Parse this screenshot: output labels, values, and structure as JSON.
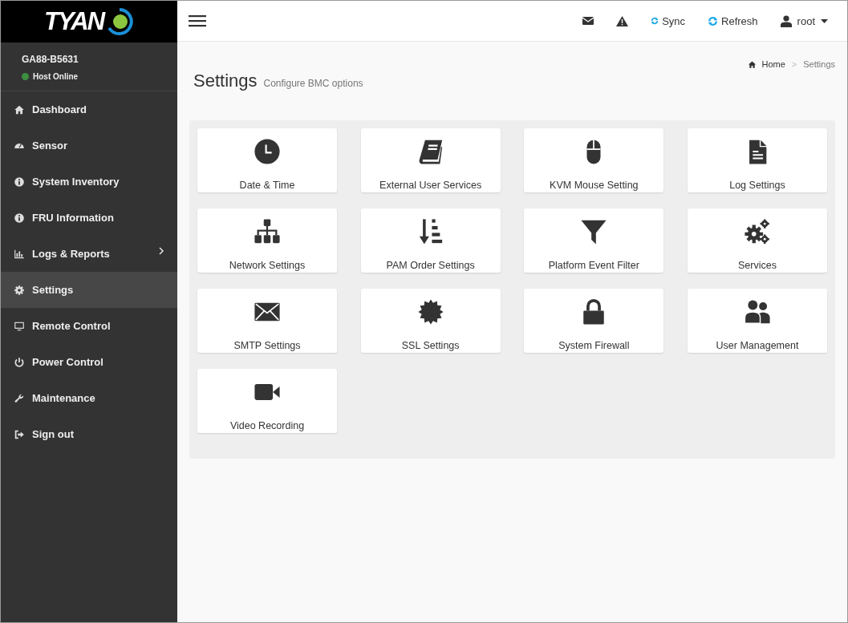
{
  "logo": {
    "text": "TYAN"
  },
  "host": {
    "name": "GA88-B5631",
    "status": "Host Online",
    "online": true
  },
  "sidebar": {
    "items": [
      {
        "label": "Dashboard",
        "kind": "home",
        "selected": false
      },
      {
        "label": "Sensor",
        "kind": "gauge",
        "selected": false
      },
      {
        "label": "System Inventory",
        "kind": "info",
        "selected": false
      },
      {
        "label": "FRU Information",
        "kind": "info",
        "selected": false
      },
      {
        "label": "Logs & Reports",
        "kind": "chart",
        "selected": false,
        "expandable": true
      },
      {
        "label": "Settings",
        "kind": "gear",
        "selected": true
      },
      {
        "label": "Remote Control",
        "kind": "monitor",
        "selected": false
      },
      {
        "label": "Power Control",
        "kind": "power",
        "selected": false
      },
      {
        "label": "Maintenance",
        "kind": "wrench",
        "selected": false
      },
      {
        "label": "Sign out",
        "kind": "signout",
        "selected": false
      }
    ]
  },
  "topbar": {
    "actions": [
      {
        "kind": "mail"
      },
      {
        "kind": "warning"
      },
      {
        "kind": "sync",
        "label": "Sync"
      },
      {
        "kind": "refresh",
        "label": "Refresh"
      },
      {
        "kind": "user",
        "label": "root"
      }
    ]
  },
  "page": {
    "title": "Settings",
    "subtitle": "Configure BMC options"
  },
  "breadcrumb": {
    "separator": ">",
    "items": [
      {
        "label": "Home",
        "kind": "home"
      },
      {
        "label": "Settings",
        "kind": "current"
      }
    ]
  },
  "tiles": [
    {
      "label": "Date & Time",
      "kind": "clock"
    },
    {
      "label": "External User Services",
      "kind": "book"
    },
    {
      "label": "KVM Mouse Setting",
      "kind": "mouse"
    },
    {
      "label": "Log Settings",
      "kind": "file"
    },
    {
      "label": "Network Settings",
      "kind": "sitemap"
    },
    {
      "label": "PAM Order Settings",
      "kind": "sort"
    },
    {
      "label": "Platform Event Filter",
      "kind": "filter"
    },
    {
      "label": "Services",
      "kind": "gears"
    },
    {
      "label": "SMTP Settings",
      "kind": "envelope"
    },
    {
      "label": "SSL Settings",
      "kind": "certificate"
    },
    {
      "label": "System Firewall",
      "kind": "lock"
    },
    {
      "label": "User Management",
      "kind": "users"
    },
    {
      "label": "Video Recording",
      "kind": "video"
    }
  ]
}
